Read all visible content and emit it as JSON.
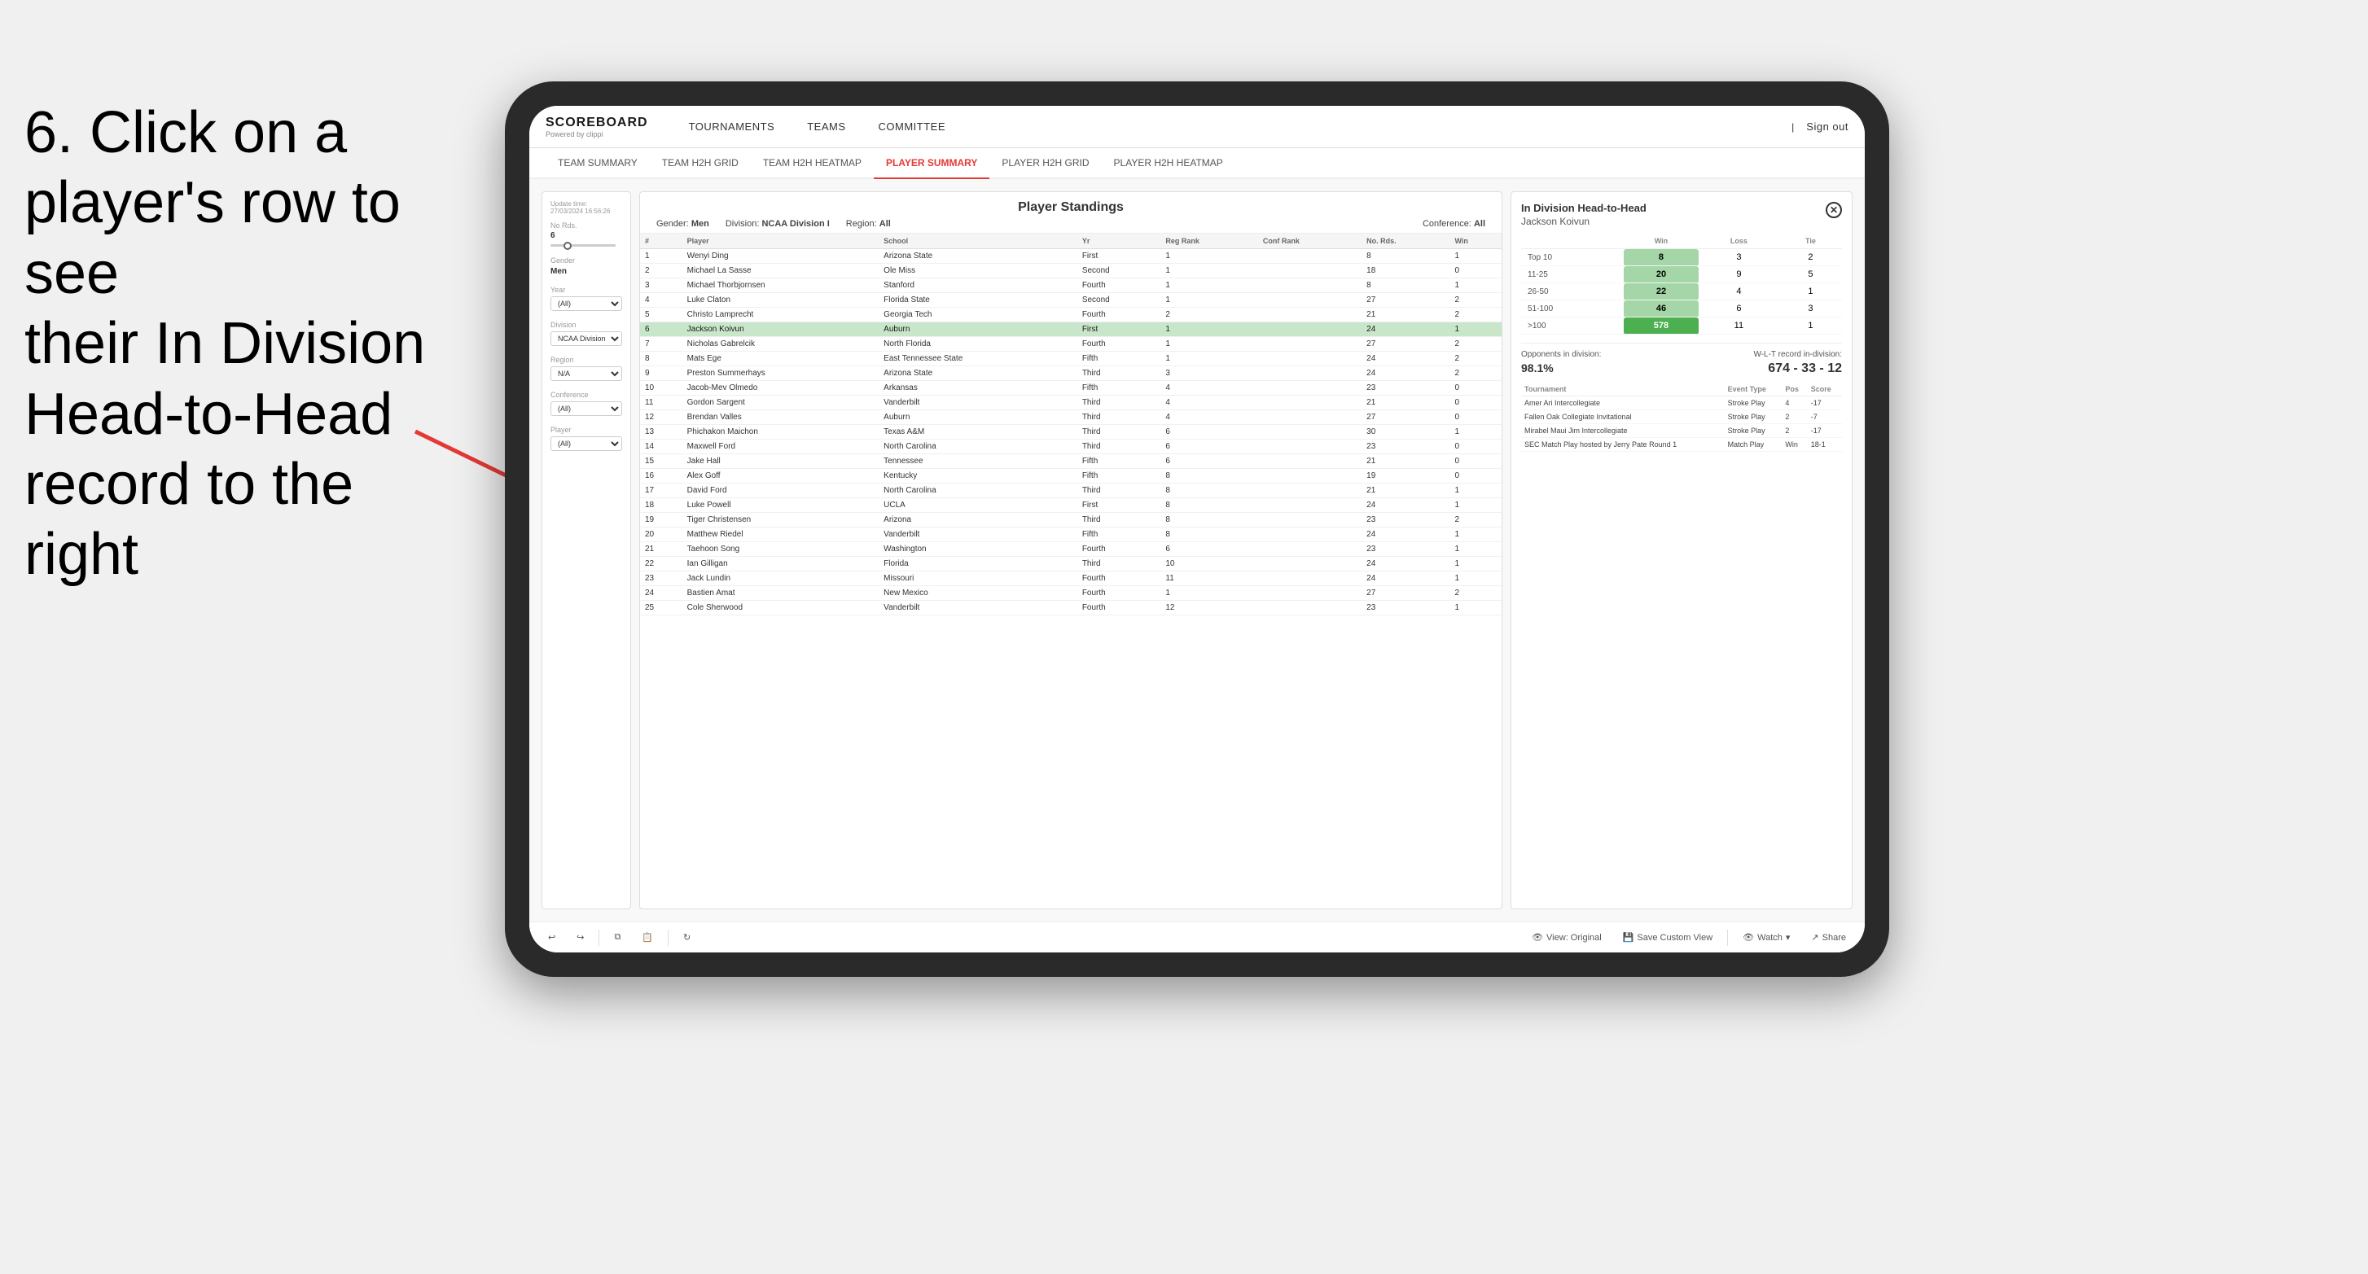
{
  "instruction": {
    "line1": "6. Click on a",
    "line2": "player's row to see",
    "line3": "their In Division",
    "line4": "Head-to-Head",
    "line5": "record to the right"
  },
  "nav": {
    "logo_title": "SCOREBOARD",
    "logo_sub": "Powered by clippi",
    "items": [
      "TOURNAMENTS",
      "TEAMS",
      "COMMITTEE"
    ],
    "sign_out": "Sign out"
  },
  "sub_nav": {
    "items": [
      "TEAM SUMMARY",
      "TEAM H2H GRID",
      "TEAM H2H HEATMAP",
      "PLAYER SUMMARY",
      "PLAYER H2H GRID",
      "PLAYER H2H HEATMAP"
    ],
    "active": "PLAYER SUMMARY"
  },
  "left_panel": {
    "update_label": "Update time:",
    "update_time": "27/03/2024 16:56:26",
    "no_rds_label": "No Rds.",
    "no_rds_value": "6",
    "gender_label": "Gender",
    "gender_value": "Men",
    "year_label": "Year",
    "year_value": "(All)",
    "division_label": "Division",
    "division_value": "NCAA Division I",
    "region_label": "Region",
    "region_value": "N/A",
    "conference_label": "Conference",
    "conference_value": "(All)",
    "player_label": "Player",
    "player_value": "(All)"
  },
  "standings": {
    "title": "Player Standings",
    "gender_label": "Gender:",
    "gender_value": "Men",
    "division_label": "Division:",
    "division_value": "NCAA Division I",
    "region_label": "Region:",
    "region_value": "All",
    "conference_label": "Conference:",
    "conference_value": "All",
    "columns": [
      "#",
      "Player",
      "School",
      "Yr",
      "Reg Rank",
      "Conf Rank",
      "No. Rds.",
      "Win"
    ],
    "rows": [
      {
        "rank": 1,
        "player": "Wenyi Ding",
        "school": "Arizona State",
        "yr": "First",
        "reg_rank": 1,
        "conf_rank": "",
        "no_rds": 8,
        "win": 1
      },
      {
        "rank": 2,
        "player": "Michael La Sasse",
        "school": "Ole Miss",
        "yr": "Second",
        "reg_rank": 1,
        "conf_rank": "",
        "no_rds": 18,
        "win": 0
      },
      {
        "rank": 3,
        "player": "Michael Thorbjornsen",
        "school": "Stanford",
        "yr": "Fourth",
        "reg_rank": 1,
        "conf_rank": "",
        "no_rds": 8,
        "win": 1
      },
      {
        "rank": 4,
        "player": "Luke Claton",
        "school": "Florida State",
        "yr": "Second",
        "reg_rank": 1,
        "conf_rank": "",
        "no_rds": 27,
        "win": 2
      },
      {
        "rank": 5,
        "player": "Christo Lamprecht",
        "school": "Georgia Tech",
        "yr": "Fourth",
        "reg_rank": 2,
        "conf_rank": "",
        "no_rds": 21,
        "win": 2
      },
      {
        "rank": 6,
        "player": "Jackson Koivun",
        "school": "Auburn",
        "yr": "First",
        "reg_rank": 1,
        "conf_rank": "",
        "no_rds": 24,
        "win": 1,
        "highlighted": true
      },
      {
        "rank": 7,
        "player": "Nicholas Gabrelcik",
        "school": "North Florida",
        "yr": "Fourth",
        "reg_rank": 1,
        "conf_rank": "",
        "no_rds": 27,
        "win": 2
      },
      {
        "rank": 8,
        "player": "Mats Ege",
        "school": "East Tennessee State",
        "yr": "Fifth",
        "reg_rank": 1,
        "conf_rank": "",
        "no_rds": 24,
        "win": 2
      },
      {
        "rank": 9,
        "player": "Preston Summerhays",
        "school": "Arizona State",
        "yr": "Third",
        "reg_rank": 3,
        "conf_rank": "",
        "no_rds": 24,
        "win": 2
      },
      {
        "rank": 10,
        "player": "Jacob-Mev Olmedo",
        "school": "Arkansas",
        "yr": "Fifth",
        "reg_rank": 4,
        "conf_rank": "",
        "no_rds": 23,
        "win": 0
      },
      {
        "rank": 11,
        "player": "Gordon Sargent",
        "school": "Vanderbilt",
        "yr": "Third",
        "reg_rank": 4,
        "conf_rank": "",
        "no_rds": 21,
        "win": 0
      },
      {
        "rank": 12,
        "player": "Brendan Valles",
        "school": "Auburn",
        "yr": "Third",
        "reg_rank": 4,
        "conf_rank": "",
        "no_rds": 27,
        "win": 0
      },
      {
        "rank": 13,
        "player": "Phichakon Maichon",
        "school": "Texas A&M",
        "yr": "Third",
        "reg_rank": 6,
        "conf_rank": "",
        "no_rds": 30,
        "win": 1
      },
      {
        "rank": 14,
        "player": "Maxwell Ford",
        "school": "North Carolina",
        "yr": "Third",
        "reg_rank": 6,
        "conf_rank": "",
        "no_rds": 23,
        "win": 0
      },
      {
        "rank": 15,
        "player": "Jake Hall",
        "school": "Tennessee",
        "yr": "Fifth",
        "reg_rank": 6,
        "conf_rank": "",
        "no_rds": 21,
        "win": 0
      },
      {
        "rank": 16,
        "player": "Alex Goff",
        "school": "Kentucky",
        "yr": "Fifth",
        "reg_rank": 8,
        "conf_rank": "",
        "no_rds": 19,
        "win": 0
      },
      {
        "rank": 17,
        "player": "David Ford",
        "school": "North Carolina",
        "yr": "Third",
        "reg_rank": 8,
        "conf_rank": "",
        "no_rds": 21,
        "win": 1
      },
      {
        "rank": 18,
        "player": "Luke Powell",
        "school": "UCLA",
        "yr": "First",
        "reg_rank": 8,
        "conf_rank": "",
        "no_rds": 24,
        "win": 1
      },
      {
        "rank": 19,
        "player": "Tiger Christensen",
        "school": "Arizona",
        "yr": "Third",
        "reg_rank": 8,
        "conf_rank": "",
        "no_rds": 23,
        "win": 2
      },
      {
        "rank": 20,
        "player": "Matthew Riedel",
        "school": "Vanderbilt",
        "yr": "Fifth",
        "reg_rank": 8,
        "conf_rank": "",
        "no_rds": 24,
        "win": 1
      },
      {
        "rank": 21,
        "player": "Taehoon Song",
        "school": "Washington",
        "yr": "Fourth",
        "reg_rank": 6,
        "conf_rank": "",
        "no_rds": 23,
        "win": 1
      },
      {
        "rank": 22,
        "player": "Ian Gilligan",
        "school": "Florida",
        "yr": "Third",
        "reg_rank": 10,
        "conf_rank": "",
        "no_rds": 24,
        "win": 1
      },
      {
        "rank": 23,
        "player": "Jack Lundin",
        "school": "Missouri",
        "yr": "Fourth",
        "reg_rank": 11,
        "conf_rank": "",
        "no_rds": 24,
        "win": 1
      },
      {
        "rank": 24,
        "player": "Bastien Amat",
        "school": "New Mexico",
        "yr": "Fourth",
        "reg_rank": 1,
        "conf_rank": "",
        "no_rds": 27,
        "win": 2
      },
      {
        "rank": 25,
        "player": "Cole Sherwood",
        "school": "Vanderbilt",
        "yr": "Fourth",
        "reg_rank": 12,
        "conf_rank": "",
        "no_rds": 23,
        "win": 1
      }
    ]
  },
  "h2h": {
    "title": "In Division Head-to-Head",
    "player": "Jackson Koivun",
    "columns": [
      "",
      "Win",
      "Loss",
      "Tie"
    ],
    "rows": [
      {
        "range": "Top 10",
        "win": 8,
        "loss": 3,
        "tie": 2,
        "win_class": "win"
      },
      {
        "range": "11-25",
        "win": 20,
        "loss": 9,
        "tie": 5,
        "win_class": "win"
      },
      {
        "range": "26-50",
        "win": 22,
        "loss": 4,
        "tie": 1,
        "win_class": "win"
      },
      {
        "range": "51-100",
        "win": 46,
        "loss": 6,
        "tie": 3,
        "win_class": "win"
      },
      {
        "range": ">100",
        "win": 578,
        "loss": 11,
        "tie": 1,
        "win_class": "big-win"
      }
    ],
    "opponents_label": "Opponents in division:",
    "opponents_pct": "98.1%",
    "wlt_label": "W-L-T record in-division:",
    "wlt_value": "674 - 33 - 12",
    "tournament_columns": [
      "Tournament",
      "Event Type",
      "Pos",
      "Score"
    ],
    "tournaments": [
      {
        "name": "Amer Ari Intercollegiate",
        "type": "Stroke Play",
        "pos": 4,
        "score": "-17"
      },
      {
        "name": "Fallen Oak Collegiate Invitational",
        "type": "Stroke Play",
        "pos": 2,
        "score": "-7"
      },
      {
        "name": "Mirabel Maui Jim Intercollegiate",
        "type": "Stroke Play",
        "pos": 2,
        "score": "-17"
      },
      {
        "name": "SEC Match Play hosted by Jerry Pate Round 1",
        "type": "Match Play",
        "pos": "Win",
        "score": "18-1"
      }
    ]
  },
  "toolbar": {
    "view_label": "View: Original",
    "save_label": "Save Custom View",
    "watch_label": "Watch",
    "share_label": "Share"
  }
}
